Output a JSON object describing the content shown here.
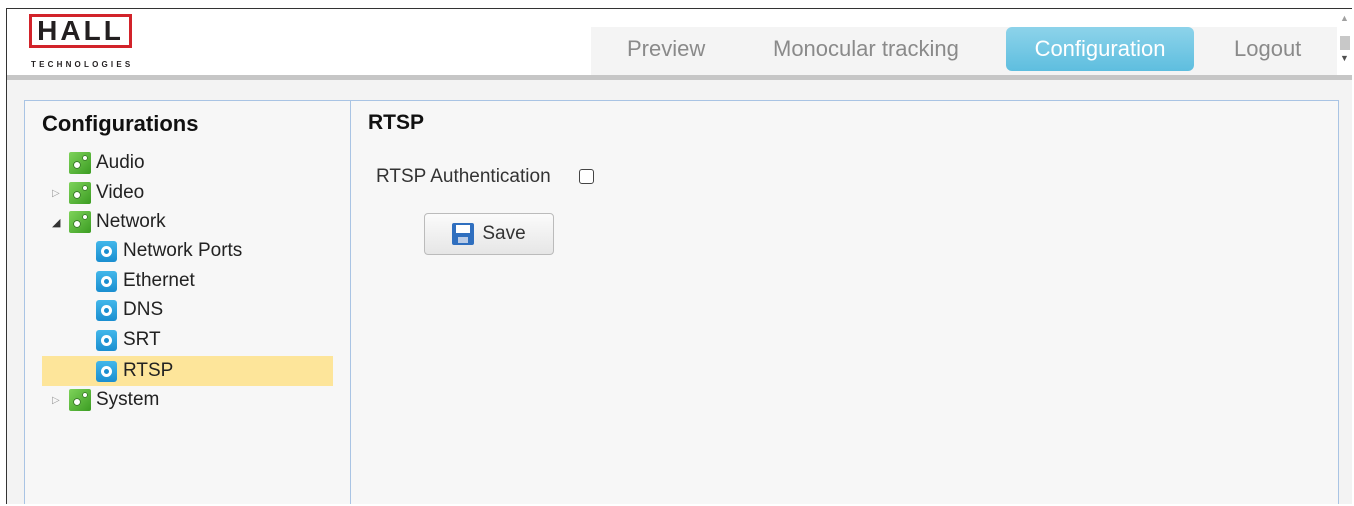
{
  "logo": {
    "word": "HALL",
    "sub": "TECHNOLOGIES"
  },
  "nav": {
    "items": [
      {
        "label": "Preview",
        "active": false
      },
      {
        "label": "Monocular tracking",
        "active": false
      },
      {
        "label": "Configuration",
        "active": true
      },
      {
        "label": "Logout",
        "active": false
      }
    ]
  },
  "sidebar": {
    "title": "Configurations",
    "items": [
      {
        "label": "Audio",
        "icon": "gear-green-icon",
        "expander": "none"
      },
      {
        "label": "Video",
        "icon": "gear-green-icon",
        "expander": "collapsed"
      },
      {
        "label": "Network",
        "icon": "gear-green-icon",
        "expander": "expanded"
      },
      {
        "label": "Network Ports",
        "icon": "gear-blue-icon"
      },
      {
        "label": "Ethernet",
        "icon": "gear-blue-icon"
      },
      {
        "label": "DNS",
        "icon": "gear-blue-icon"
      },
      {
        "label": "SRT",
        "icon": "gear-blue-icon"
      },
      {
        "label": "RTSP",
        "icon": "gear-blue-icon",
        "selected": true
      },
      {
        "label": "System",
        "icon": "gear-green-icon",
        "expander": "collapsed"
      }
    ]
  },
  "main": {
    "title": "RTSP",
    "auth_label": "RTSP Authentication",
    "auth_checked": false,
    "save_label": "Save"
  },
  "colors": {
    "accent": "#5ebedf",
    "selected_row": "#fde59a",
    "panel_border": "#a9c4e4",
    "logo_red": "#d2232a"
  }
}
